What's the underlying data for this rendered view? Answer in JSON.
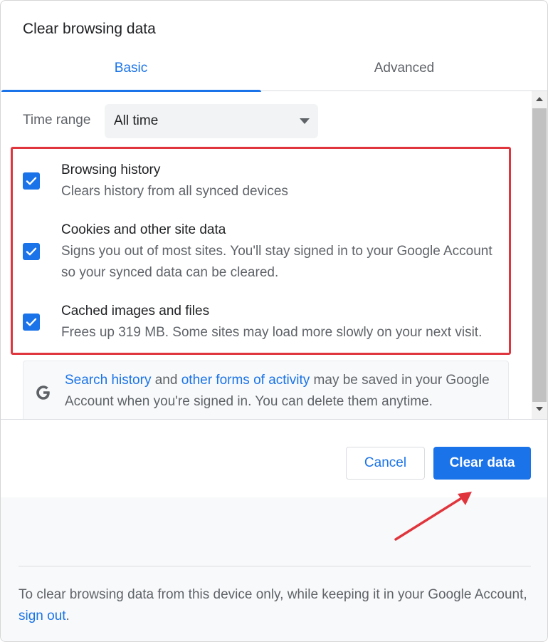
{
  "dialog": {
    "title": "Clear browsing data"
  },
  "tabs": [
    {
      "label": "Basic",
      "active": true
    },
    {
      "label": "Advanced",
      "active": false
    }
  ],
  "time_range": {
    "label": "Time range",
    "value": "All time"
  },
  "options": [
    {
      "title": "Browsing history",
      "desc": "Clears history from all synced devices",
      "checked": true
    },
    {
      "title": "Cookies and other site data",
      "desc": "Signs you out of most sites. You'll stay signed in to your Google Account so your synced data can be cleared.",
      "checked": true
    },
    {
      "title": "Cached images and files",
      "desc": "Frees up 319 MB. Some sites may load more slowly on your next visit.",
      "checked": true
    }
  ],
  "info": {
    "link1": "Search history",
    "text1": " and ",
    "link2": "other forms of activity",
    "text2": " may be saved in your Google Account when you're signed in. You can delete them anytime."
  },
  "buttons": {
    "cancel": "Cancel",
    "clear": "Clear data"
  },
  "footer": {
    "text": "To clear browsing data from this device only, while keeping it in your Google Account, ",
    "link": "sign out",
    "end": "."
  },
  "colors": {
    "accent": "#1a73e8",
    "highlight": "#e0353d"
  },
  "icons": {
    "select_arrow": "caret-down-icon",
    "checkbox": "check-icon",
    "google": "google-g-icon",
    "annotation": "red-arrow-icon"
  }
}
